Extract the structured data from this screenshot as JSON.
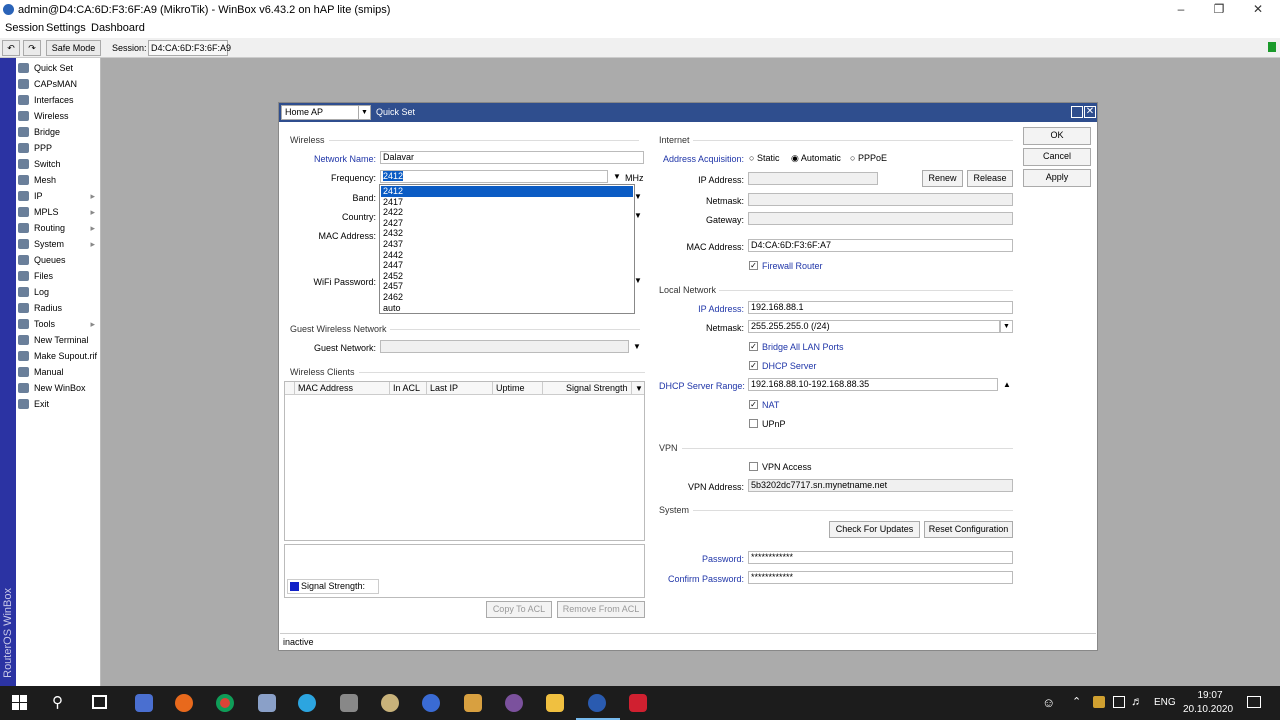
{
  "window": {
    "title": "admin@D4:CA:6D:F3:6F:A9 (MikroTik) - WinBox v6.43.2 on hAP lite (smips)"
  },
  "menu": [
    "Session",
    "Settings",
    "Dashboard"
  ],
  "toolbar": {
    "safe_mode": "Safe Mode",
    "session_label": "Session:",
    "session_value": "D4:CA:6D:F3:6F:A9"
  },
  "vertical_label": "RouterOS WinBox",
  "sidebar": [
    {
      "label": "Quick Set",
      "icon": "quickset-icon",
      "sub": false
    },
    {
      "label": "CAPsMAN",
      "icon": "capsman-icon",
      "sub": false
    },
    {
      "label": "Interfaces",
      "icon": "interfaces-icon",
      "sub": false
    },
    {
      "label": "Wireless",
      "icon": "wireless-icon",
      "sub": false
    },
    {
      "label": "Bridge",
      "icon": "bridge-icon",
      "sub": false
    },
    {
      "label": "PPP",
      "icon": "ppp-icon",
      "sub": false
    },
    {
      "label": "Switch",
      "icon": "switch-icon",
      "sub": false
    },
    {
      "label": "Mesh",
      "icon": "mesh-icon",
      "sub": false
    },
    {
      "label": "IP",
      "icon": "ip-icon",
      "sub": true
    },
    {
      "label": "MPLS",
      "icon": "mpls-icon",
      "sub": true
    },
    {
      "label": "Routing",
      "icon": "routing-icon",
      "sub": true
    },
    {
      "label": "System",
      "icon": "system-icon",
      "sub": true
    },
    {
      "label": "Queues",
      "icon": "queues-icon",
      "sub": false
    },
    {
      "label": "Files",
      "icon": "files-icon",
      "sub": false
    },
    {
      "label": "Log",
      "icon": "log-icon",
      "sub": false
    },
    {
      "label": "Radius",
      "icon": "radius-icon",
      "sub": false
    },
    {
      "label": "Tools",
      "icon": "tools-icon",
      "sub": true
    },
    {
      "label": "New Terminal",
      "icon": "terminal-icon",
      "sub": false
    },
    {
      "label": "Make Supout.rif",
      "icon": "supout-icon",
      "sub": false
    },
    {
      "label": "Manual",
      "icon": "manual-icon",
      "sub": false
    },
    {
      "label": "New WinBox",
      "icon": "winbox-icon",
      "sub": false
    },
    {
      "label": "Exit",
      "icon": "exit-icon",
      "sub": false
    }
  ],
  "dialog": {
    "mode": "Home AP",
    "title": "Quick Set",
    "wireless": {
      "section": "Wireless",
      "network_name_label": "Network Name:",
      "network_name": "Dalavar",
      "frequency_label": "Frequency:",
      "frequency": "2412",
      "frequency_unit": "MHz",
      "band_label": "Band:",
      "country_label": "Country:",
      "mac_label": "MAC Address:",
      "wifi_password_label": "WiFi Password:"
    },
    "guest": {
      "section": "Guest Wireless Network",
      "label": "Guest Network:",
      "value": ""
    },
    "clients": {
      "section": "Wireless Clients",
      "columns": [
        "MAC Address",
        "In ACL",
        "Last IP",
        "Uptime",
        "Signal Strength"
      ],
      "legend": "Signal Strength:",
      "copy_btn": "Copy To ACL",
      "remove_btn": "Remove From ACL"
    },
    "frequency_options": [
      "2412",
      "2417",
      "2422",
      "2427",
      "2432",
      "2437",
      "2442",
      "2447",
      "2452",
      "2457",
      "2462",
      "auto"
    ],
    "internet": {
      "section": "Internet",
      "acq_label": "Address Acquisition:",
      "opt_static": "Static",
      "opt_auto": "Automatic",
      "opt_pppoe": "PPPoE",
      "ip_label": "IP Address:",
      "renew": "Renew",
      "release": "Release",
      "netmask_label": "Netmask:",
      "gateway_label": "Gateway:",
      "mac_label": "MAC Address:",
      "mac_value": "D4:CA:6D:F3:6F:A7",
      "firewall": "Firewall Router"
    },
    "local": {
      "section": "Local Network",
      "ip_label": "IP Address:",
      "ip_value": "192.168.88.1",
      "netmask_label": "Netmask:",
      "netmask_value": "255.255.255.0 (/24)",
      "bridge_all": "Bridge All LAN Ports",
      "dhcp_server": "DHCP Server",
      "dhcp_range_label": "DHCP Server Range:",
      "dhcp_range": "192.168.88.10-192.168.88.35",
      "nat": "NAT",
      "upnp": "UPnP"
    },
    "vpn": {
      "section": "VPN",
      "access": "VPN Access",
      "address_label": "VPN Address:",
      "address": "5b3202dc7717.sn.mynetname.net"
    },
    "system": {
      "section": "System",
      "check_updates": "Check For Updates",
      "reset_config": "Reset Configuration",
      "password_label": "Password:",
      "password": "************",
      "confirm_label": "Confirm Password:",
      "confirm": "************"
    },
    "buttons": {
      "ok": "OK",
      "cancel": "Cancel",
      "apply": "Apply"
    },
    "status": "inactive"
  },
  "taskbar": {
    "lang": "ENG",
    "time": "19:07",
    "date": "20.10.2020"
  },
  "colors": {
    "winbox_blue": "#2b33a3",
    "title_blue": "#2f4e8e",
    "selection": "#0b5cc4",
    "label_blue": "#1f35a8"
  }
}
